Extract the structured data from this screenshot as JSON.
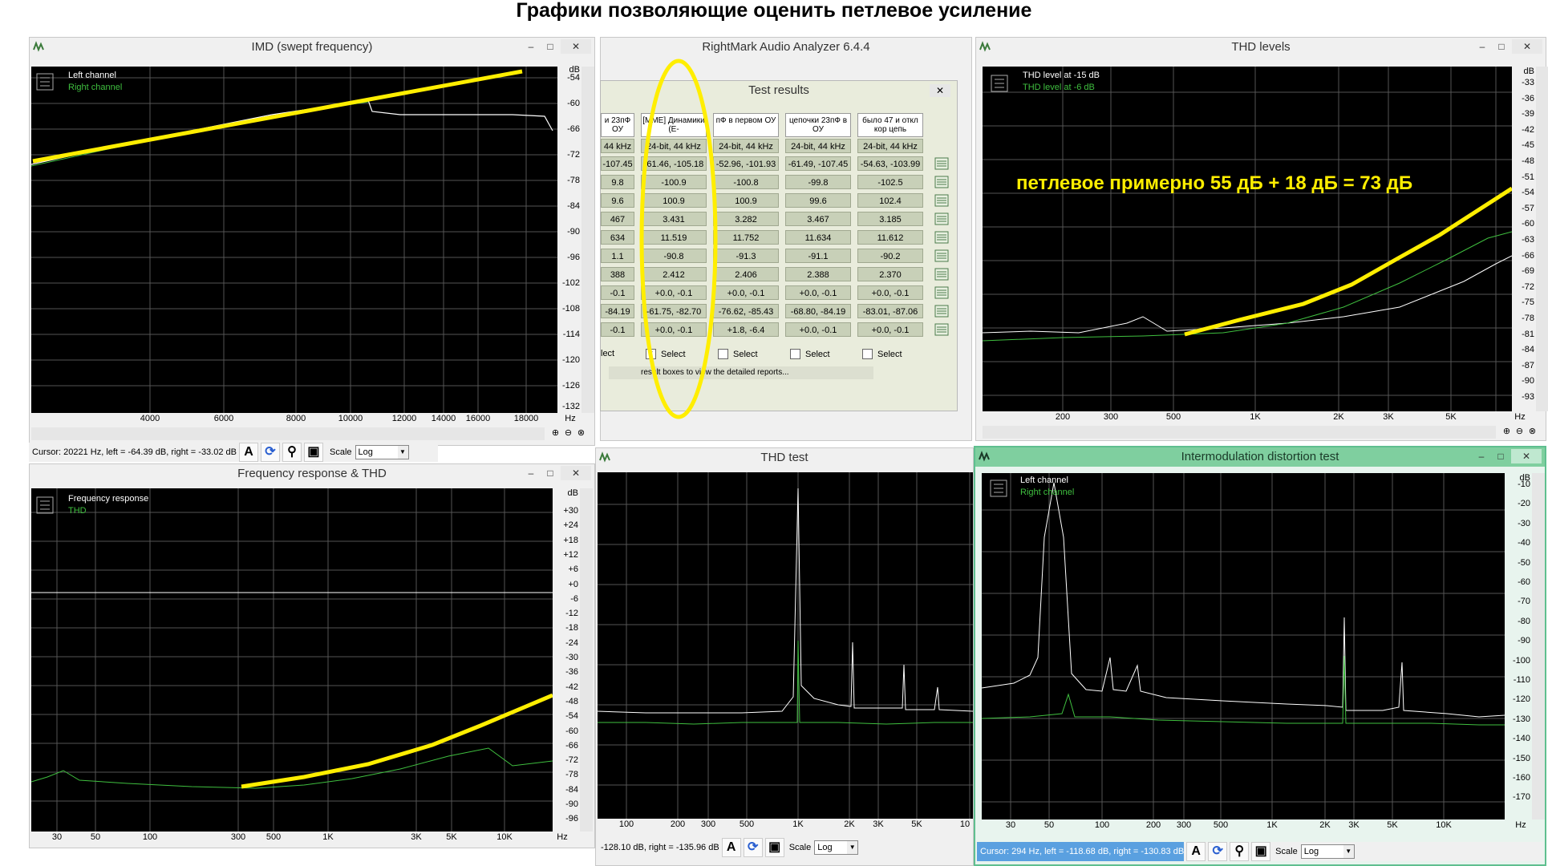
{
  "heading": "Графики позволяющие оценить петлевое усиление",
  "colors": {
    "plot_bg": "#000000",
    "white_trace": "#ffffff",
    "green_trace": "#3fbf3f",
    "annotation": "#ffee00",
    "active_title": "#7fcf9f"
  },
  "windows": {
    "imd_swept": {
      "title": "IMD (swept frequency)",
      "legend": [
        "Left channel",
        "Right channel"
      ],
      "y_unit": "dB",
      "y_ticks": [
        "-54",
        "-60",
        "-66",
        "-72",
        "-78",
        "-84",
        "-90",
        "-96",
        "-102",
        "-108",
        "-114",
        "-120",
        "-126",
        "-132"
      ],
      "x_unit": "Hz",
      "x_ticks": [
        "4000",
        "6000",
        "8000",
        "10000",
        "12000",
        "14000",
        "16000",
        "18000"
      ],
      "status": "Cursor:  20221 Hz,  left = -64.39 dB,  right = -33.02 dB",
      "scale_label": "Scale",
      "scale_value": "Log"
    },
    "rmaa": {
      "title": "RightMark Audio Analyzer 6.4.4"
    },
    "thd_levels": {
      "title": "THD levels",
      "legend": [
        "THD level at -15 dB",
        "THD level at -6 dB"
      ],
      "y_unit": "dB",
      "y_ticks": [
        "-33",
        "-36",
        "-39",
        "-42",
        "-45",
        "-48",
        "-51",
        "-54",
        "-57",
        "-60",
        "-63",
        "-66",
        "-69",
        "-72",
        "-75",
        "-78",
        "-81",
        "-84",
        "-87",
        "-90",
        "-93"
      ],
      "x_unit": "Hz",
      "x_ticks": [
        "200",
        "300",
        "500",
        "1K",
        "2K",
        "3K",
        "5K"
      ],
      "annotation": "петлевое примерно 55 дБ + 18 дБ = 73 дБ"
    },
    "freq_response": {
      "title": "Frequency response & THD",
      "legend": [
        "Frequency response",
        "THD"
      ],
      "y_unit": "dB",
      "y_ticks": [
        "+30",
        "+24",
        "+18",
        "+12",
        "+6",
        "+0",
        "-6",
        "-12",
        "-18",
        "-24",
        "-30",
        "-36",
        "-42",
        "-48",
        "-54",
        "-60",
        "-66",
        "-72",
        "-78",
        "-84",
        "-90",
        "-96"
      ],
      "x_unit": "Hz",
      "x_ticks": [
        "30",
        "50",
        "100",
        "300",
        "500",
        "1K",
        "3K",
        "5K",
        "10K"
      ]
    },
    "thd_test": {
      "title": "THD test",
      "x_ticks": [
        "100",
        "200",
        "300",
        "500",
        "1K",
        "2K",
        "3K",
        "5K",
        "10"
      ],
      "status": "-128.10 dB,  right = -135.96 dB",
      "scale_label": "Scale",
      "scale_value": "Log"
    },
    "imd_test": {
      "title": "Intermodulation distortion test",
      "legend": [
        "Left channel",
        "Right channel"
      ],
      "y_unit": "dB",
      "y_ticks": [
        "-10",
        "-20",
        "-30",
        "-40",
        "-50",
        "-60",
        "-70",
        "-80",
        "-90",
        "-100",
        "-110",
        "-120",
        "-130",
        "-140",
        "-150",
        "-160",
        "-170"
      ],
      "x_unit": "Hz",
      "x_ticks": [
        "30",
        "50",
        "100",
        "200",
        "300",
        "500",
        "1K",
        "2K",
        "3K",
        "5K",
        "10K"
      ],
      "status": "Cursor:  294 Hz,  left = -118.68 dB,  right = -130.83 dB",
      "scale_label": "Scale",
      "scale_value": "Log"
    }
  },
  "test_results": {
    "title": "Test results",
    "columns": [
      {
        "header": "и 23пФ ОУ",
        "rate": "44 kHz"
      },
      {
        "header": "[MME] Динамики (E-",
        "rate": "24-bit, 44 kHz"
      },
      {
        "header": "пФ в первом ОУ",
        "rate": "24-bit, 44 kHz"
      },
      {
        "header": "цепочки 23пФ в ОУ",
        "rate": "24-bit, 44 kHz"
      },
      {
        "header": "было 47 и откл кор цепь",
        "rate": "24-bit, 44 kHz"
      }
    ],
    "rows": [
      [
        "-107.45",
        "-61.46, -105.18",
        "-52.96, -101.93",
        "-61.49, -107.45",
        "-54.63, -103.99"
      ],
      [
        "9.8",
        "-100.9",
        "-100.8",
        "-99.8",
        "-102.5"
      ],
      [
        "9.6",
        "100.9",
        "100.9",
        "99.6",
        "102.4"
      ],
      [
        "467",
        "3.431",
        "3.282",
        "3.467",
        "3.185"
      ],
      [
        "634",
        "11.519",
        "11.752",
        "11.634",
        "11.612"
      ],
      [
        "1.1",
        "-90.8",
        "-91.3",
        "-91.1",
        "-90.2"
      ],
      [
        "388",
        "2.412",
        "2.406",
        "2.388",
        "2.370"
      ],
      [
        "-0.1",
        "+0.0, -0.1",
        "+0.0, -0.1",
        "+0.0, -0.1",
        "+0.0, -0.1"
      ],
      [
        "-84.19",
        "-61.75, -82.70",
        "-76.62, -85.43",
        "-68.80, -84.19",
        "-83.01, -87.06"
      ],
      [
        "-0.1",
        "+0.0, -0.1",
        "+1.8, -6.4",
        "+0.0, -0.1",
        "+0.0, -0.1"
      ]
    ],
    "select_labels": [
      "lect",
      "Select",
      "Select",
      "Select",
      "Select"
    ],
    "hint": "result boxes to view the detailed reports..."
  }
}
